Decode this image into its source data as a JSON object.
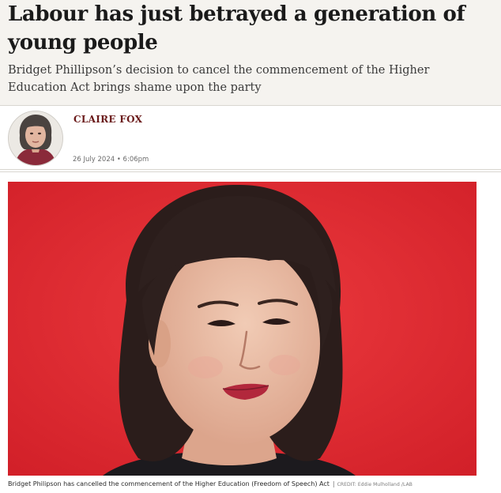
{
  "article": {
    "headline": "Labour has just betrayed a generation of young people",
    "standfirst": "Bridget Phillipson’s decision to cancel the commencement of the Higher Education Act brings shame upon the party"
  },
  "byline": {
    "author": "CLAIRE FOX",
    "timestamp": "26 July 2024 • 6:06pm"
  },
  "image": {
    "caption": "Bridget Philipson has cancelled the commencement of the Higher Education (Freedom of Speech) Act",
    "separator": "|",
    "credit": "CREDIT: Eddie Mulholland /LAB"
  },
  "colors": {
    "header_background": "#f5f3ef",
    "author_color": "#6a1a1a",
    "photo_background": "#e0262e"
  }
}
